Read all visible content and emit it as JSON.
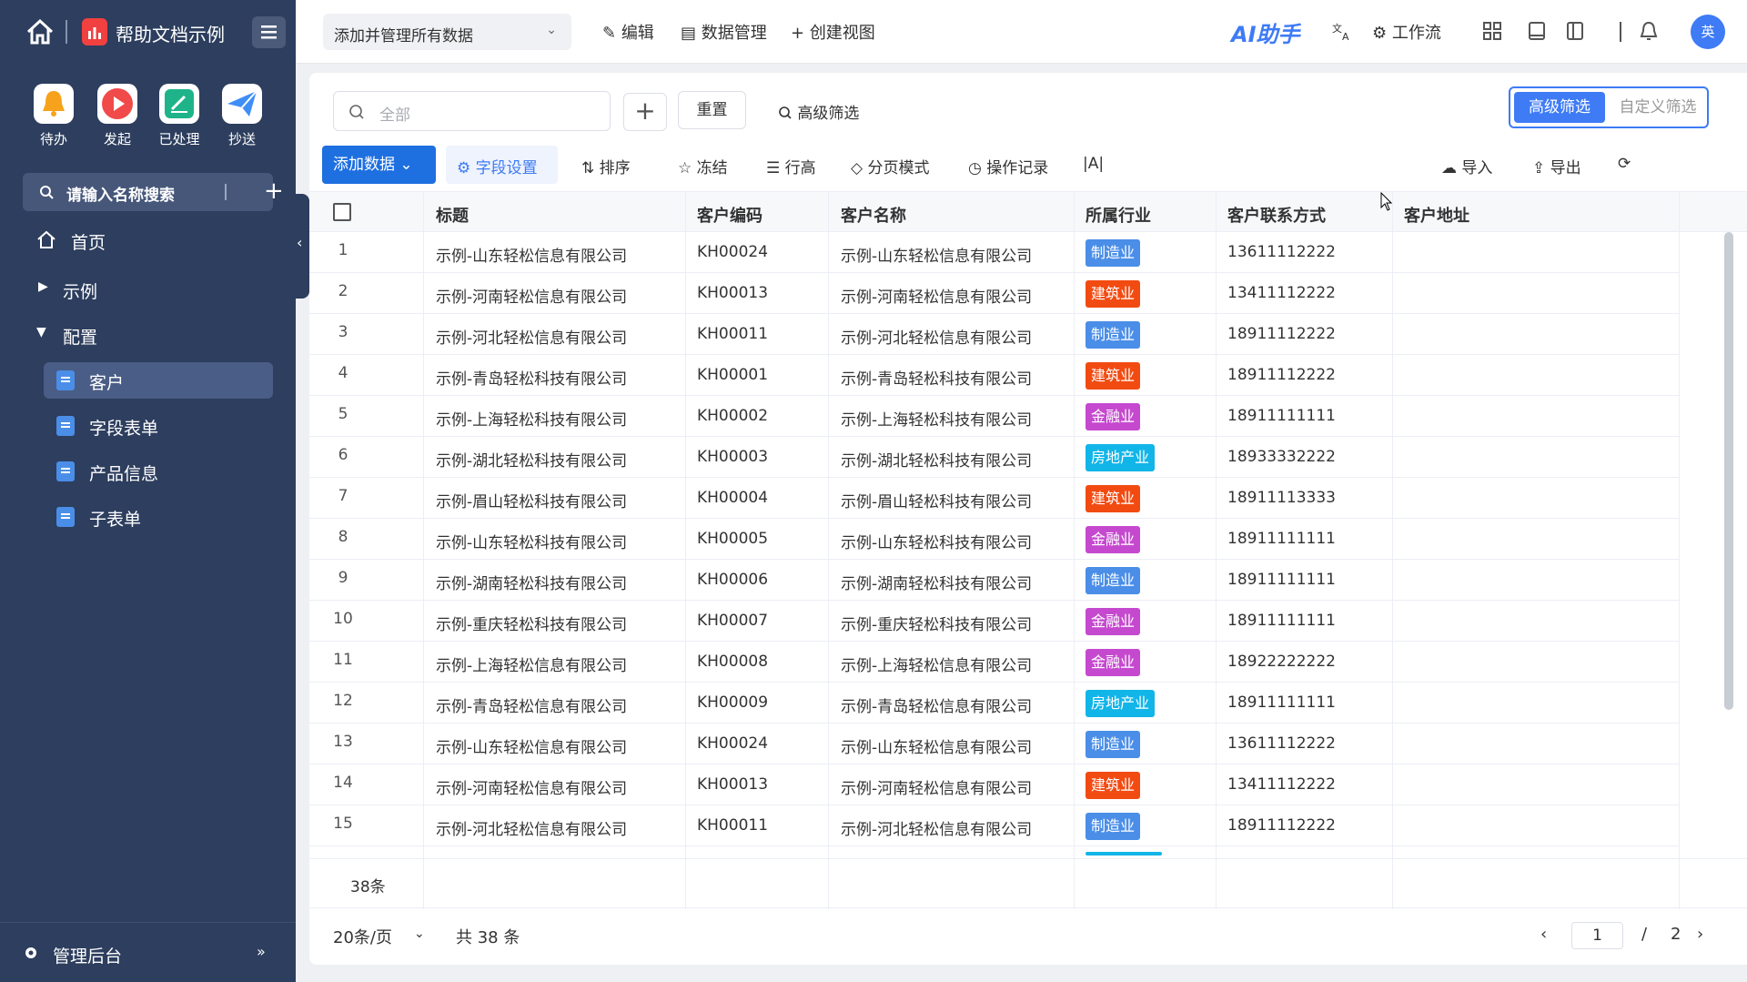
{
  "sidebar": {
    "app_title": "帮助文档示例",
    "quick_actions": [
      {
        "label": "待办",
        "color": "#f7a21b"
      },
      {
        "label": "发起",
        "color": "#f04a4a"
      },
      {
        "label": "已处理",
        "color": "#1fb38a"
      },
      {
        "label": "抄送",
        "color": "#3e8ef5"
      }
    ],
    "search_placeholder": "请输入名称搜索",
    "nav": {
      "home": "首页",
      "example": "示例",
      "config": "配置",
      "sub_items": [
        "客户",
        "字段表单",
        "产品信息",
        "子表单"
      ]
    },
    "footer": "管理后台"
  },
  "topbar": {
    "view_name": "添加并管理所有数据",
    "edit": "编辑",
    "data_manage": "数据管理",
    "create_view": "创建视图",
    "ai_assistant": "AI助手",
    "workflow": "工作流",
    "avatar_text": "英"
  },
  "filter": {
    "search_placeholder": "全部",
    "reset": "重置",
    "advanced": "高级筛选",
    "seg_advanced": "高级筛选",
    "seg_custom": "自定义筛选"
  },
  "toolbar": {
    "add_data": "添加数据",
    "field_settings": "字段设置",
    "sort": "排序",
    "freeze": "冻结",
    "row_height": "行高",
    "page_mode": "分页模式",
    "history": "操作记录",
    "text_mode": "|A|",
    "import": "导入",
    "export": "导出"
  },
  "table": {
    "columns": [
      "标题",
      "客户编码",
      "客户名称",
      "所属行业",
      "客户联系方式",
      "客户地址"
    ],
    "industry_colors": {
      "制造业": "#4a8ee8",
      "建筑业": "#f24b12",
      "金融业": "#c549cf",
      "房地产业": "#12b5e8"
    },
    "rows": [
      {
        "n": "1",
        "title": "示例-山东轻松信息有限公司",
        "code": "KH00024",
        "name": "示例-山东轻松信息有限公司",
        "industry": "制造业",
        "phone": "13611112222"
      },
      {
        "n": "2",
        "title": "示例-河南轻松信息有限公司",
        "code": "KH00013",
        "name": "示例-河南轻松信息有限公司",
        "industry": "建筑业",
        "phone": "13411112222"
      },
      {
        "n": "3",
        "title": "示例-河北轻松信息有限公司",
        "code": "KH00011",
        "name": "示例-河北轻松信息有限公司",
        "industry": "制造业",
        "phone": "18911112222"
      },
      {
        "n": "4",
        "title": "示例-青岛轻松科技有限公司",
        "code": "KH00001",
        "name": "示例-青岛轻松科技有限公司",
        "industry": "建筑业",
        "phone": "18911112222"
      },
      {
        "n": "5",
        "title": "示例-上海轻松科技有限公司",
        "code": "KH00002",
        "name": "示例-上海轻松科技有限公司",
        "industry": "金融业",
        "phone": "18911111111"
      },
      {
        "n": "6",
        "title": "示例-湖北轻松科技有限公司",
        "code": "KH00003",
        "name": "示例-湖北轻松科技有限公司",
        "industry": "房地产业",
        "phone": "18933332222"
      },
      {
        "n": "7",
        "title": "示例-眉山轻松科技有限公司",
        "code": "KH00004",
        "name": "示例-眉山轻松科技有限公司",
        "industry": "建筑业",
        "phone": "18911113333"
      },
      {
        "n": "8",
        "title": "示例-山东轻松科技有限公司",
        "code": "KH00005",
        "name": "示例-山东轻松科技有限公司",
        "industry": "金融业",
        "phone": "18911111111"
      },
      {
        "n": "9",
        "title": "示例-湖南轻松科技有限公司",
        "code": "KH00006",
        "name": "示例-湖南轻松科技有限公司",
        "industry": "制造业",
        "phone": "18911111111"
      },
      {
        "n": "10",
        "title": "示例-重庆轻松科技有限公司",
        "code": "KH00007",
        "name": "示例-重庆轻松科技有限公司",
        "industry": "金融业",
        "phone": "18911111111"
      },
      {
        "n": "11",
        "title": "示例-上海轻松信息有限公司",
        "code": "KH00008",
        "name": "示例-上海轻松信息有限公司",
        "industry": "金融业",
        "phone": "18922222222"
      },
      {
        "n": "12",
        "title": "示例-青岛轻松信息有限公司",
        "code": "KH00009",
        "name": "示例-青岛轻松信息有限公司",
        "industry": "房地产业",
        "phone": "18911111111"
      },
      {
        "n": "13",
        "title": "示例-山东轻松信息有限公司",
        "code": "KH00024",
        "name": "示例-山东轻松信息有限公司",
        "industry": "制造业",
        "phone": "13611112222"
      },
      {
        "n": "14",
        "title": "示例-河南轻松信息有限公司",
        "code": "KH00013",
        "name": "示例-河南轻松信息有限公司",
        "industry": "建筑业",
        "phone": "13411112222"
      },
      {
        "n": "15",
        "title": "示例-河北轻松信息有限公司",
        "code": "KH00011",
        "name": "示例-河北轻松信息有限公司",
        "industry": "制造业",
        "phone": "18911112222"
      }
    ],
    "summary_count": "38条"
  },
  "pagination": {
    "page_size": "20条/页",
    "total": "共 38 条",
    "current_page": "1",
    "separator": "/",
    "total_pages": "2"
  }
}
